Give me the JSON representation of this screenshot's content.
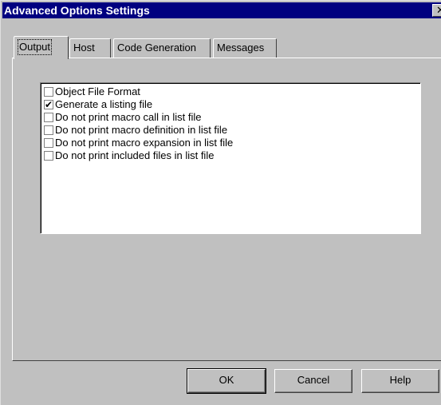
{
  "window": {
    "title": "Advanced Options Settings",
    "close_glyph": "✕"
  },
  "tabs": [
    {
      "label": "Output",
      "active": true
    },
    {
      "label": "Host",
      "active": false
    },
    {
      "label": "Code Generation",
      "active": false
    },
    {
      "label": "Messages",
      "active": false
    }
  ],
  "options": [
    {
      "label": "Object File Format",
      "checked": false
    },
    {
      "label": "Generate a listing file",
      "checked": true
    },
    {
      "label": "Do not print macro call in list file",
      "checked": false
    },
    {
      "label": "Do not print macro definition in list file",
      "checked": false
    },
    {
      "label": "Do not print macro expansion in list file",
      "checked": false
    },
    {
      "label": "Do not print included files in list file",
      "checked": false
    }
  ],
  "buttons": {
    "ok": "OK",
    "cancel": "Cancel",
    "help": "Help"
  },
  "check_glyph": "✔"
}
